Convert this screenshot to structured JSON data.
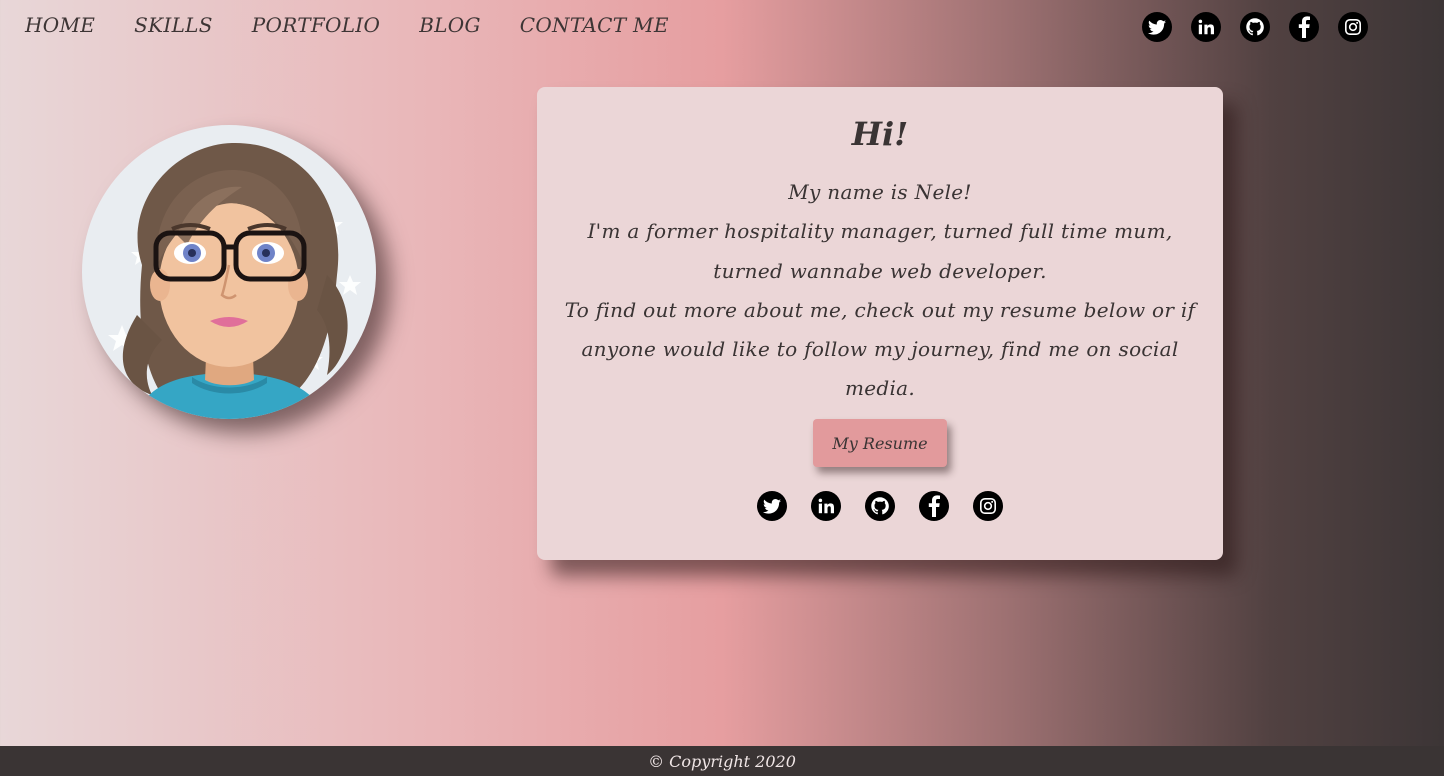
{
  "nav": {
    "links": [
      "HOME",
      "SKILLS",
      "PORTFOLIO",
      "BLOG",
      "CONTACT ME"
    ]
  },
  "social_icons": [
    "twitter-icon",
    "linkedin-icon",
    "github-icon",
    "facebook-icon",
    "instagram-icon"
  ],
  "card": {
    "greeting": "Hi!",
    "intro_line1": "My name is Nele!",
    "intro_line2": "I'm a former hospitality manager, turned full time mum, turned wannabe web developer.",
    "intro_line3": "To find out more about me, check out my resume below or if anyone would like to follow my journey, find me on social media.",
    "resume_button": "My Resume"
  },
  "footer": {
    "copyright": "© Copyright 2020"
  },
  "colors": {
    "accent_button": "#e29a9c",
    "card_background": "#ebd6d7",
    "footer_background": "#3a3434"
  }
}
